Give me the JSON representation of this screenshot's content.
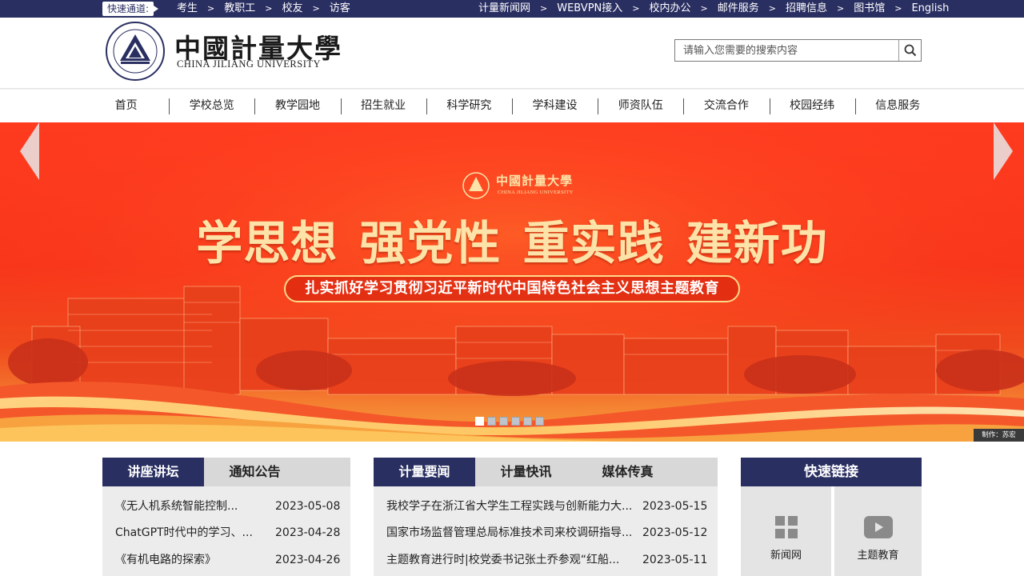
{
  "topbar": {
    "quick_label": "快速通道:",
    "left_links": [
      "考生",
      "教职工",
      "校友",
      "访客"
    ],
    "right_links": [
      "计量新闻网",
      "WEBVPN接入",
      "校内办公",
      "邮件服务",
      "招聘信息",
      "图书馆",
      "English"
    ],
    "sep": ">"
  },
  "header": {
    "brand_cn": "中國計量大學",
    "brand_en": "CHINA JILIANG UNIVERSITY",
    "search_placeholder": "请输入您需要的搜索内容"
  },
  "nav": {
    "items": [
      "首页",
      "学校总览",
      "教学园地",
      "招生就业",
      "科学研究",
      "学科建设",
      "师资队伍",
      "交流合作",
      "校园经纬",
      "信息服务"
    ]
  },
  "banner": {
    "logo_cn": "中國計量大學",
    "logo_en": "CHINA JILIANG UNIVERSITY",
    "title": "学思想 强党性 重实践 建新功",
    "subtitle": "扎实抓好学习贯彻习近平新时代中国特色社会主义思想主题教育",
    "credit": "制作：苏宏",
    "slide_count": 6,
    "active_slide": 1
  },
  "panel_lectures": {
    "tabs": [
      "讲座讲坛",
      "通知公告"
    ],
    "active_tab": 0,
    "rows": [
      {
        "title": "《无人机系统智能控制...",
        "date": "2023-05-08"
      },
      {
        "title": "ChatGPT时代中的学习、...",
        "date": "2023-04-28"
      },
      {
        "title": "《有机电路的探索》",
        "date": "2023-04-26"
      }
    ]
  },
  "panel_news": {
    "tabs": [
      "计量要闻",
      "计量快讯",
      "媒体传真"
    ],
    "active_tab": 0,
    "rows": [
      {
        "title": "我校学子在浙江省大学生工程实践与创新能力大...",
        "date": "2023-05-15"
      },
      {
        "title": "国家市场监督管理总局标准技术司来校调研指导...",
        "date": "2023-05-12"
      },
      {
        "title": "主题教育进行时|校党委书记张土乔参观“红船...",
        "date": "2023-05-11"
      }
    ]
  },
  "quick_links": {
    "title": "快速链接",
    "items": [
      {
        "label": "新闻网",
        "icon": "grid-icon"
      },
      {
        "label": "主题教育",
        "icon": "play-icon"
      }
    ]
  },
  "colors": {
    "primary": "#2a2f62",
    "banner_red": "#f8361a",
    "banner_gold": "#fde3a8"
  }
}
